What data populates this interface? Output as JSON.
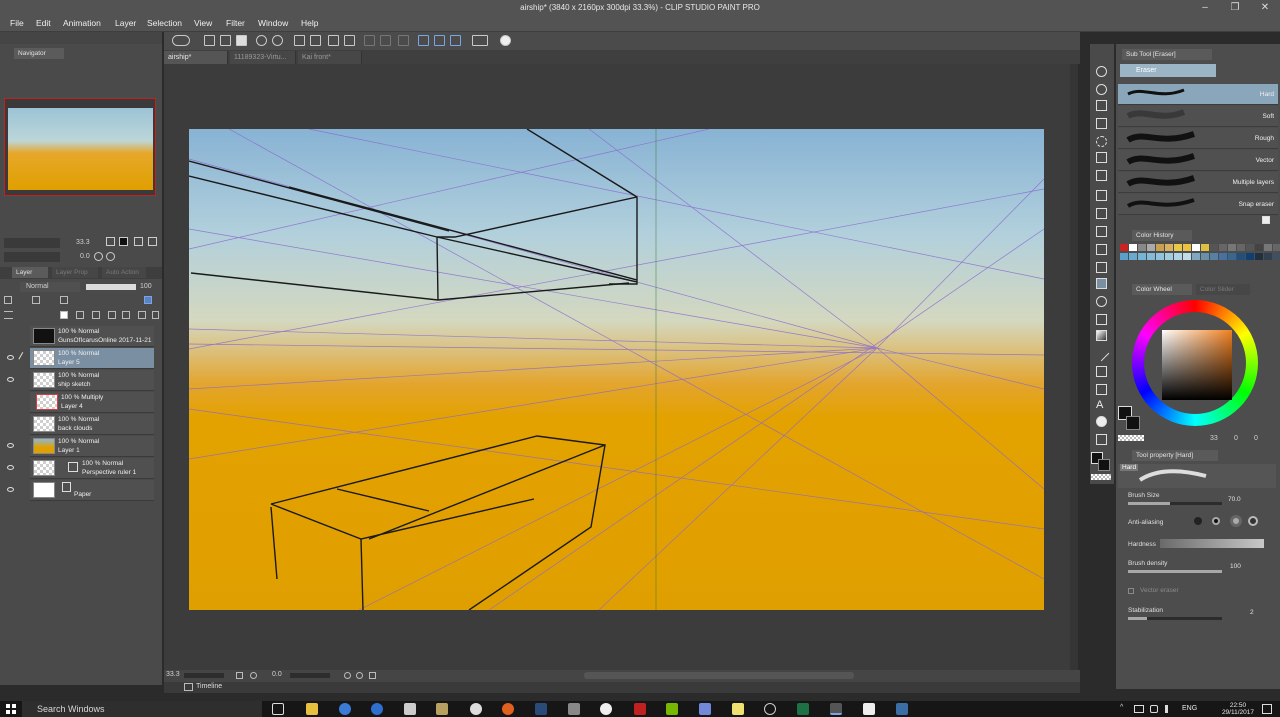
{
  "window": {
    "title": "airship* (3840 x 2160px 300dpi 33.3%) - CLIP STUDIO PAINT PRO"
  },
  "menu": [
    "File",
    "Edit",
    "Animation",
    "Layer",
    "Selection",
    "View",
    "Filter",
    "Window",
    "Help"
  ],
  "navigator": {
    "tab_label": "Navigator",
    "zoom": "33.3",
    "rotation": "0.0"
  },
  "layer_panel": {
    "tabs": [
      "Layer",
      "Layer Prop",
      "Auto Action"
    ],
    "blend_mode": "Normal",
    "opacity": "100",
    "layers": [
      {
        "line1": "100 % Normal",
        "line2": "GunsOfIcarusOnline 2017-11-21 16-4...",
        "selected": false,
        "visible": false
      },
      {
        "line1": "100 % Normal",
        "line2": "Layer 5",
        "selected": true,
        "visible": true
      },
      {
        "line1": "100 % Normal",
        "line2": "ship sketch",
        "selected": false,
        "visible": true
      },
      {
        "line1": "100 % Multiply",
        "line2": "Layer 4",
        "selected": false,
        "visible": false
      },
      {
        "line1": "100 % Normal",
        "line2": "back clouds",
        "selected": false,
        "visible": false
      },
      {
        "line1": "100 % Normal",
        "line2": "Layer 1",
        "selected": false,
        "visible": true
      },
      {
        "line1": "100 % Normal",
        "line2": "Perspective ruler 1",
        "selected": false,
        "visible": true
      },
      {
        "line1": "",
        "line2": "Paper",
        "selected": false,
        "visible": true
      }
    ]
  },
  "doc_tabs": [
    "airship*",
    "11189323-Virtu...",
    "Kai front*"
  ],
  "status": {
    "zoom": "33.3",
    "angle": "0.0"
  },
  "timeline": {
    "label": "Timeline"
  },
  "sub_tool": {
    "header": "Sub Tool [Eraser]",
    "group": "Eraser",
    "brushes": [
      "Hard",
      "Soft",
      "Rough",
      "Vector",
      "Multiple layers",
      "Snap eraser"
    ],
    "selected": "Hard"
  },
  "color_history": {
    "label": "Color History"
  },
  "color_wheel": {
    "tabs": [
      "Color Wheel",
      "Color Slider"
    ],
    "readout": [
      "33",
      "0",
      "0"
    ]
  },
  "tool_property": {
    "header": "Tool property [Hard]",
    "preset_label": "Hard",
    "brush_size_label": "Brush Size",
    "brush_size_value": "70.0",
    "brush_size_level": 0.45,
    "anti_aliasing_label": "Anti-aliasing",
    "hardness_label": "Hardness",
    "brush_density_label": "Brush density",
    "brush_density_value": "100",
    "brush_density_level": 1.0,
    "vector_eraser_label": "Vector eraser",
    "stabilization_label": "Stabilization",
    "stabilization_value": "2",
    "stabilization_level": 0.2
  },
  "taskbar": {
    "search_placeholder": "Search Windows",
    "lang": "ENG",
    "time": "22:50",
    "date": "29/11/2017"
  },
  "colors": {
    "sky_top": "#88b3d4",
    "ground": "#e09f00",
    "perspective_line": "#8a6ad0",
    "selection": "#7b8fa3"
  }
}
